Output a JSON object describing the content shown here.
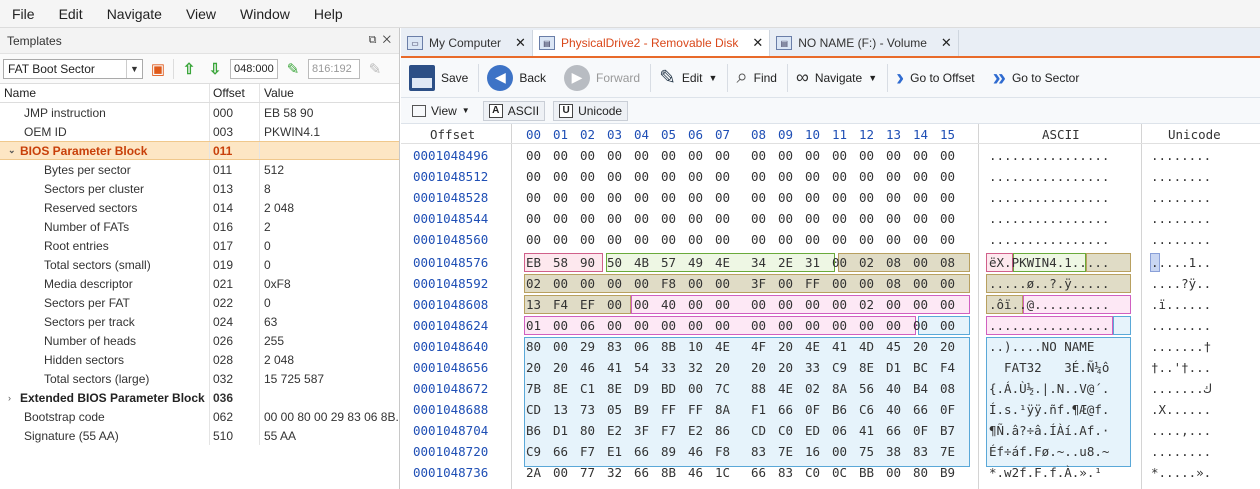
{
  "menu": [
    "File",
    "Edit",
    "Navigate",
    "View",
    "Window",
    "Help"
  ],
  "templates": {
    "title": "Templates",
    "selector": "FAT Boot Sector",
    "offset_input": "048:000",
    "size_input": "816:192",
    "columns": [
      "Name",
      "Offset",
      "Value"
    ],
    "rows": [
      {
        "name": "JMP instruction",
        "offset": "000",
        "value": "EB 58 90",
        "indent": 1
      },
      {
        "name": "OEM ID",
        "offset": "003",
        "value": "PKWIN4.1",
        "indent": 1
      },
      {
        "name": "BIOS Parameter Block",
        "offset": "011",
        "value": "",
        "indent": 0,
        "expand": "open",
        "selected": true
      },
      {
        "name": "Bytes per sector",
        "offset": "011",
        "value": "512",
        "indent": 2
      },
      {
        "name": "Sectors per cluster",
        "offset": "013",
        "value": "8",
        "indent": 2
      },
      {
        "name": "Reserved sectors",
        "offset": "014",
        "value": "2 048",
        "indent": 2
      },
      {
        "name": "Number of FATs",
        "offset": "016",
        "value": "2",
        "indent": 2
      },
      {
        "name": "Root entries",
        "offset": "017",
        "value": "0",
        "indent": 2
      },
      {
        "name": "Total sectors (small)",
        "offset": "019",
        "value": "0",
        "indent": 2
      },
      {
        "name": "Media descriptor",
        "offset": "021",
        "value": "0xF8",
        "indent": 2
      },
      {
        "name": "Sectors per FAT",
        "offset": "022",
        "value": "0",
        "indent": 2
      },
      {
        "name": "Sectors per track",
        "offset": "024",
        "value": "63",
        "indent": 2
      },
      {
        "name": "Number of heads",
        "offset": "026",
        "value": "255",
        "indent": 2
      },
      {
        "name": "Hidden sectors",
        "offset": "028",
        "value": "2 048",
        "indent": 2
      },
      {
        "name": "Total sectors (large)",
        "offset": "032",
        "value": "15 725 587",
        "indent": 2
      },
      {
        "name": "Extended BIOS Parameter Block",
        "offset": "036",
        "value": "",
        "indent": 0,
        "expand": "closed",
        "bold": true
      },
      {
        "name": "Bootstrap code",
        "offset": "062",
        "value": "00 00 80 00 29 83 06 8B...",
        "indent": 1
      },
      {
        "name": "Signature (55 AA)",
        "offset": "510",
        "value": "55 AA",
        "indent": 1
      }
    ]
  },
  "tabs": [
    {
      "label": "My Computer",
      "active": false
    },
    {
      "label": "PhysicalDrive2 - Removable Disk",
      "active": true
    },
    {
      "label": "NO NAME (F:) - Volume",
      "active": false
    }
  ],
  "toolbar": {
    "save": "Save",
    "back": "Back",
    "forward": "Forward",
    "edit": "Edit",
    "find": "Find",
    "navigate": "Navigate",
    "goto_offset": "Go to Offset",
    "goto_sector": "Go to Sector"
  },
  "toolbar2": {
    "view": "View",
    "ascii": "ASCII",
    "unicode": "Unicode"
  },
  "hex": {
    "offset_header": "Offset",
    "byte_headers": [
      "00",
      "01",
      "02",
      "03",
      "04",
      "05",
      "06",
      "07",
      "08",
      "09",
      "10",
      "11",
      "12",
      "13",
      "14",
      "15"
    ],
    "ascii_header": "ASCII",
    "unicode_header": "Unicode",
    "rows": [
      {
        "offset": "0001048496",
        "bytes": [
          "00",
          "00",
          "00",
          "00",
          "00",
          "00",
          "00",
          "00",
          "00",
          "00",
          "00",
          "00",
          "00",
          "00",
          "00",
          "00"
        ],
        "ascii": "................",
        "unicode": "........"
      },
      {
        "offset": "0001048512",
        "bytes": [
          "00",
          "00",
          "00",
          "00",
          "00",
          "00",
          "00",
          "00",
          "00",
          "00",
          "00",
          "00",
          "00",
          "00",
          "00",
          "00"
        ],
        "ascii": "................",
        "unicode": "........"
      },
      {
        "offset": "0001048528",
        "bytes": [
          "00",
          "00",
          "00",
          "00",
          "00",
          "00",
          "00",
          "00",
          "00",
          "00",
          "00",
          "00",
          "00",
          "00",
          "00",
          "00"
        ],
        "ascii": "................",
        "unicode": "........"
      },
      {
        "offset": "0001048544",
        "bytes": [
          "00",
          "00",
          "00",
          "00",
          "00",
          "00",
          "00",
          "00",
          "00",
          "00",
          "00",
          "00",
          "00",
          "00",
          "00",
          "00"
        ],
        "ascii": "................",
        "unicode": "........"
      },
      {
        "offset": "0001048560",
        "bytes": [
          "00",
          "00",
          "00",
          "00",
          "00",
          "00",
          "00",
          "00",
          "00",
          "00",
          "00",
          "00",
          "00",
          "00",
          "00",
          "00"
        ],
        "ascii": "................",
        "unicode": "........"
      },
      {
        "offset": "0001048576",
        "bytes": [
          "EB",
          "58",
          "90",
          "50",
          "4B",
          "57",
          "49",
          "4E",
          "34",
          "2E",
          "31",
          "00",
          "02",
          "08",
          "00",
          "08"
        ],
        "ascii": "ëX.PKWIN4.1.....",
        "unicode": ".....1.."
      },
      {
        "offset": "0001048592",
        "bytes": [
          "02",
          "00",
          "00",
          "00",
          "00",
          "F8",
          "00",
          "00",
          "3F",
          "00",
          "FF",
          "00",
          "00",
          "08",
          "00",
          "00"
        ],
        "ascii": ".....ø..?.ÿ.....",
        "unicode": "....?ÿ.."
      },
      {
        "offset": "0001048608",
        "bytes": [
          "13",
          "F4",
          "EF",
          "00",
          "00",
          "40",
          "00",
          "00",
          "00",
          "00",
          "00",
          "00",
          "02",
          "00",
          "00",
          "00"
        ],
        "ascii": ".ôï..@..........",
        "unicode": ".ï......"
      },
      {
        "offset": "0001048624",
        "bytes": [
          "01",
          "00",
          "06",
          "00",
          "00",
          "00",
          "00",
          "00",
          "00",
          "00",
          "00",
          "00",
          "00",
          "00",
          "00",
          "00"
        ],
        "ascii": "................",
        "unicode": "........"
      },
      {
        "offset": "0001048640",
        "bytes": [
          "80",
          "00",
          "29",
          "83",
          "06",
          "8B",
          "10",
          "4E",
          "4F",
          "20",
          "4E",
          "41",
          "4D",
          "45",
          "20",
          "20"
        ],
        "ascii": "..)....NO NAME  ",
        "unicode": ".......†"
      },
      {
        "offset": "0001048656",
        "bytes": [
          "20",
          "20",
          "46",
          "41",
          "54",
          "33",
          "32",
          "20",
          "20",
          "20",
          "33",
          "C9",
          "8E",
          "D1",
          "BC",
          "F4"
        ],
        "ascii": "  FAT32   3É.Ñ¼ô",
        "unicode": "†..'†..."
      },
      {
        "offset": "0001048672",
        "bytes": [
          "7B",
          "8E",
          "C1",
          "8E",
          "D9",
          "BD",
          "00",
          "7C",
          "88",
          "4E",
          "02",
          "8A",
          "56",
          "40",
          "B4",
          "08"
        ],
        "ascii": "{.Á.Ù½.|.N..V@´.",
        "unicode": ".......ك"
      },
      {
        "offset": "0001048688",
        "bytes": [
          "CD",
          "13",
          "73",
          "05",
          "B9",
          "FF",
          "FF",
          "8A",
          "F1",
          "66",
          "0F",
          "B6",
          "C6",
          "40",
          "66",
          "0F"
        ],
        "ascii": "Í.s.¹ÿÿ.ñf.¶Æ@f.",
        "unicode": ".X......"
      },
      {
        "offset": "0001048704",
        "bytes": [
          "B6",
          "D1",
          "80",
          "E2",
          "3F",
          "F7",
          "E2",
          "86",
          "CD",
          "C0",
          "ED",
          "06",
          "41",
          "66",
          "0F",
          "B7"
        ],
        "ascii": "¶Ñ.â?÷â.ÍÀí.Af.·",
        "unicode": "....,..."
      },
      {
        "offset": "0001048720",
        "bytes": [
          "C9",
          "66",
          "F7",
          "E1",
          "66",
          "89",
          "46",
          "F8",
          "83",
          "7E",
          "16",
          "00",
          "75",
          "38",
          "83",
          "7E"
        ],
        "ascii": "Éf÷áf.Fø.~..u8.~",
        "unicode": "........"
      },
      {
        "offset": "0001048736",
        "bytes": [
          "2A",
          "00",
          "77",
          "32",
          "66",
          "8B",
          "46",
          "1C",
          "66",
          "83",
          "C0",
          "0C",
          "BB",
          "00",
          "80",
          "B9"
        ],
        "ascii": "*.w2f.F.f.À.».¹",
        "unicode": "*.....»."
      }
    ]
  }
}
